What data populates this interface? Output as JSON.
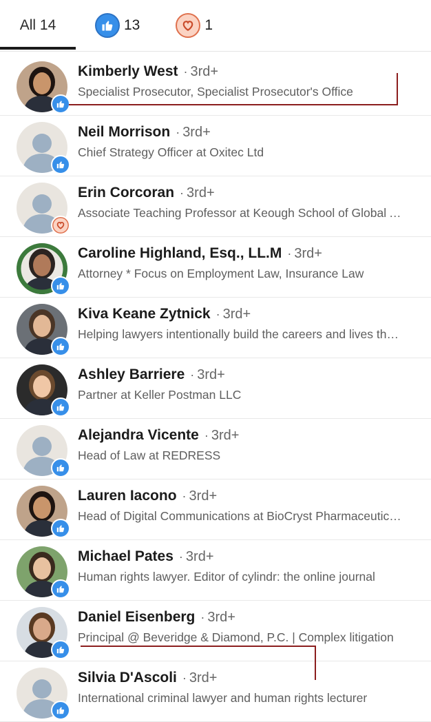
{
  "tabs": [
    {
      "label": "All 14"
    },
    {
      "icon": "thumbs-up-icon",
      "count": "13"
    },
    {
      "icon": "heart-icon",
      "count": "1"
    }
  ],
  "colors": {
    "like": "#378fe9",
    "love_bg": "#fbd3c3",
    "love_stroke": "#df704d",
    "markup": "#8b1d1d"
  },
  "people": [
    {
      "name": "Kimberly West",
      "degree": "3rd+",
      "headline": "Specialist Prosecutor, Specialist Prosecutor's Office",
      "reaction": "like",
      "avatar": "photo"
    },
    {
      "name": "Neil Morrison",
      "degree": "3rd+",
      "headline": "Chief Strategy Officer at Oxitec Ltd",
      "reaction": "like",
      "avatar": "placeholder"
    },
    {
      "name": "Erin Corcoran",
      "degree": "3rd+",
      "headline": "Associate Teaching Professor at Keough School of Global Affairs",
      "reaction": "love",
      "avatar": "placeholder"
    },
    {
      "name": "Caroline Highland, Esq., LL.M",
      "degree": "3rd+",
      "headline": "Attorney * Focus on Employment Law, Insurance Law",
      "reaction": "like",
      "avatar": "photo-opentowork"
    },
    {
      "name": "Kiva Keane Zytnick",
      "degree": "3rd+",
      "headline": "Helping lawyers intentionally build the careers and lives they want",
      "reaction": "like",
      "avatar": "photo"
    },
    {
      "name": "Ashley Barriere",
      "degree": "3rd+",
      "headline": "Partner at Keller Postman LLC",
      "reaction": "like",
      "avatar": "photo"
    },
    {
      "name": "Alejandra Vicente",
      "degree": "3rd+",
      "headline": "Head of Law at REDRESS",
      "reaction": "like",
      "avatar": "placeholder"
    },
    {
      "name": "Lauren Iacono",
      "degree": "3rd+",
      "headline": "Head of Digital Communications at BioCryst Pharmaceuticals",
      "reaction": "like",
      "avatar": "photo"
    },
    {
      "name": "Michael Pates",
      "degree": "3rd+",
      "headline": "Human rights lawyer. Editor of cylindr: the online journal",
      "reaction": "like",
      "avatar": "photo"
    },
    {
      "name": "Daniel Eisenberg",
      "degree": "3rd+",
      "headline": "Principal @ Beveridge & Diamond, P.C. | Complex litigation",
      "reaction": "like",
      "avatar": "photo"
    },
    {
      "name": "Silvia D'Ascoli",
      "degree": "3rd+",
      "headline": "International criminal lawyer and human rights lecturer",
      "reaction": "like",
      "avatar": "placeholder"
    }
  ]
}
